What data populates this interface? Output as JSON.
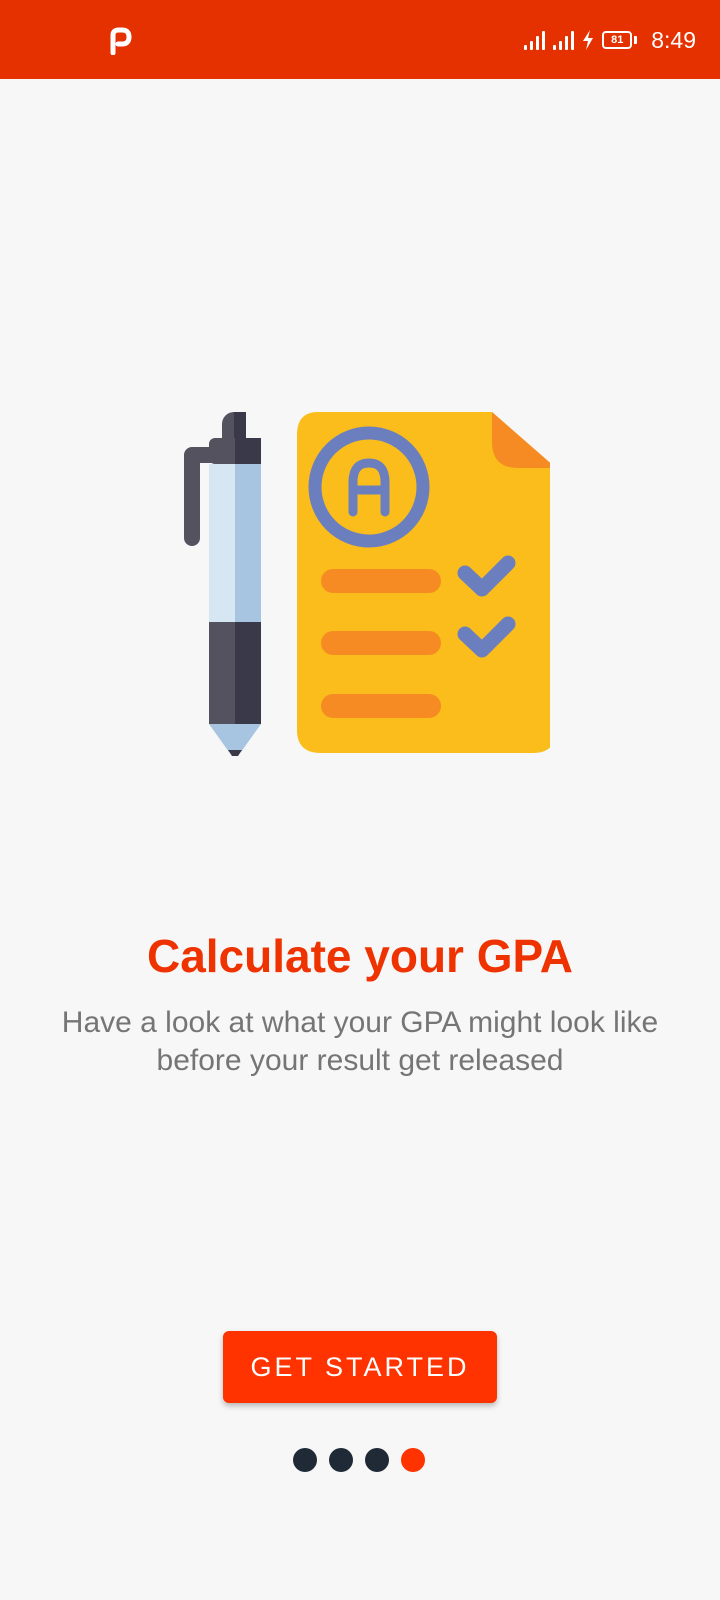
{
  "status_bar": {
    "time": "8:49",
    "battery_level": "81",
    "background_color": "#e53000",
    "icons": [
      "p-app-icon",
      "signal-icon",
      "signal-icon",
      "charging-bolt-icon",
      "battery-icon"
    ]
  },
  "onboarding": {
    "illustration": "pen-and-graded-paper-illustration",
    "illustration_grade_letter": "A",
    "title": "Calculate your GPA",
    "description": "Have a look at what your GPA might look like before your result get released",
    "cta_label": "GET STARTED",
    "page_count": 4,
    "active_page_index": 3
  },
  "colors": {
    "accent": "#ff3300",
    "title": "#ee3200",
    "description": "#757575",
    "inactive_dot": "#1f2a36",
    "background": "#f7f7f7"
  }
}
